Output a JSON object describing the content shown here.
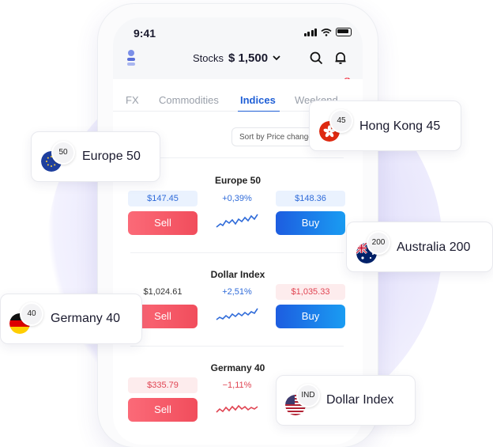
{
  "status": {
    "time": "9:41"
  },
  "header": {
    "account_type": "Stocks",
    "balance": "$ 1,500",
    "notifications": "1"
  },
  "tabs": [
    {
      "label": "FX"
    },
    {
      "label": "Commodities"
    },
    {
      "label": "Indices",
      "active": true
    },
    {
      "label": "Weekend"
    }
  ],
  "sort": {
    "label": "Sort by Price change"
  },
  "instruments": [
    {
      "name": "Europe 50",
      "sell_price": "$147.45",
      "change": "+0,39%",
      "buy_price": "$148.36",
      "sell_label": "Sell",
      "buy_label": "Buy",
      "trend": "up"
    },
    {
      "name": "Dollar Index",
      "sell_price": "$1,024.61",
      "change": "+2,51%",
      "buy_price": "$1,035.33",
      "sell_label": "Sell",
      "buy_label": "Buy",
      "trend": "up"
    },
    {
      "name": "Germany 40",
      "sell_price": "$335.79",
      "change": "−1,11%",
      "sell_label": "Sell",
      "trend": "down"
    }
  ],
  "floating_cards": [
    {
      "name": "Europe 50",
      "badge": "50",
      "flag": "eu"
    },
    {
      "name": "Hong Kong 45",
      "badge": "45",
      "flag": "hk"
    },
    {
      "name": "Australia 200",
      "badge": "200",
      "flag": "au"
    },
    {
      "name": "Germany 40",
      "badge": "40",
      "flag": "de"
    },
    {
      "name": "Dollar Index",
      "badge": "IND",
      "flag": "us"
    }
  ],
  "colors": {
    "accent": "#1f5fd6",
    "sell": "#f14d5c",
    "buy": "#1d5de0",
    "up": "#2f6bd9",
    "down": "#e04452"
  }
}
